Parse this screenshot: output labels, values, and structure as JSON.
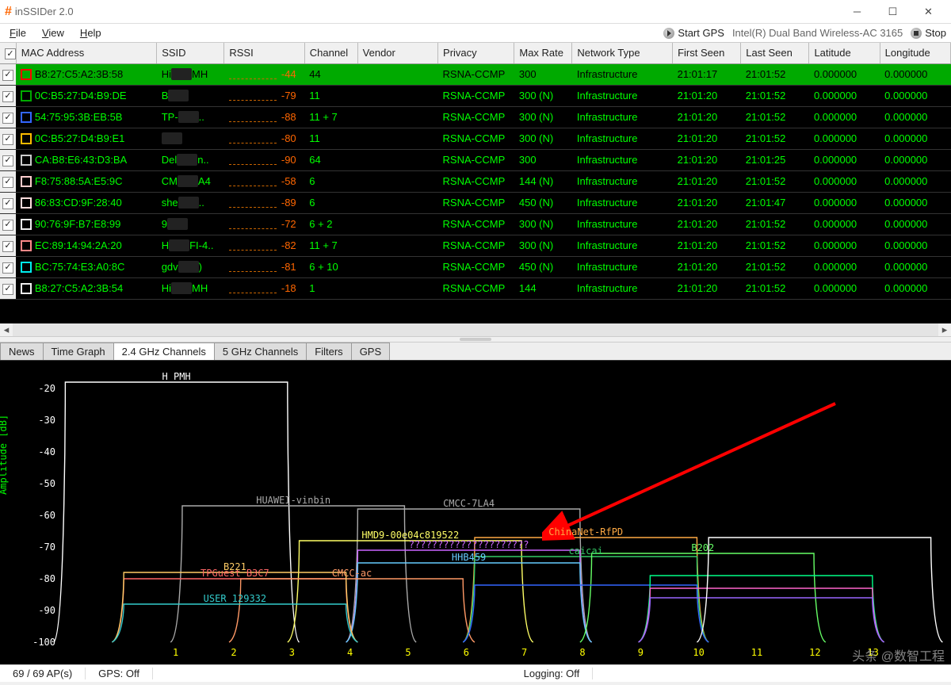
{
  "window": {
    "title": "inSSIDer 2.0",
    "logo": "#"
  },
  "menu": {
    "file": "File",
    "view": "View",
    "help": "Help",
    "start_gps": "Start GPS",
    "adapter": "Intel(R) Dual Band Wireless-AC 3165",
    "stop": "Stop"
  },
  "columns": [
    "MAC Address",
    "SSID",
    "RSSI",
    "Channel",
    "Vendor",
    "Privacy",
    "Max Rate",
    "Network Type",
    "First Seen",
    "Last Seen",
    "Latitude",
    "Longitude"
  ],
  "rows": [
    {
      "chip": "#f00",
      "mac": "B8:27:C5:A2:3B:58",
      "ssid": "Hi",
      "ssid_ob": "MH",
      "rssi": -44,
      "ch": "44",
      "vendor": "",
      "privacy": "RSNA-CCMP",
      "rate": "300",
      "ntype": "Infrastructure",
      "first": "21:01:17",
      "last": "21:01:52",
      "lat": "0.000000",
      "lon": "0.000000",
      "sel": true
    },
    {
      "chip": "#0a0",
      "mac": "0C:B5:27:D4:B9:DE",
      "ssid": "B",
      "ssid_ob": "",
      "rssi": -79,
      "ch": "11",
      "vendor": "",
      "privacy": "RSNA-CCMP",
      "rate": "300 (N)",
      "ntype": "Infrastructure",
      "first": "21:01:20",
      "last": "21:01:52",
      "lat": "0.000000",
      "lon": "0.000000"
    },
    {
      "chip": "#36f",
      "mac": "54:75:95:3B:EB:5B",
      "ssid": "TP-",
      "ssid_ob": "..",
      "rssi": -88,
      "ch": "11 + 7",
      "vendor": "",
      "privacy": "RSNA-CCMP",
      "rate": "300 (N)",
      "ntype": "Infrastructure",
      "first": "21:01:20",
      "last": "21:01:52",
      "lat": "0.000000",
      "lon": "0.000000"
    },
    {
      "chip": "#fb0",
      "mac": "0C:B5:27:D4:B9:E1",
      "ssid": "",
      "ssid_ob": "",
      "rssi": -80,
      "ch": "11",
      "vendor": "",
      "privacy": "RSNA-CCMP",
      "rate": "300 (N)",
      "ntype": "Infrastructure",
      "first": "21:01:20",
      "last": "21:01:52",
      "lat": "0.000000",
      "lon": "0.000000"
    },
    {
      "chip": "#ccc",
      "mac": "CA:B8:E6:43:D3:BA",
      "ssid": "Del",
      "ssid_ob": "n..",
      "rssi": -90,
      "ch": "64",
      "vendor": "",
      "privacy": "RSNA-CCMP",
      "rate": "300",
      "ntype": "Infrastructure",
      "first": "21:01:20",
      "last": "21:01:25",
      "lat": "0.000000",
      "lon": "0.000000"
    },
    {
      "chip": "#fcc",
      "mac": "F8:75:88:5A:E5:9C",
      "ssid": "CM",
      "ssid_ob": "A4",
      "rssi": -58,
      "ch": "6",
      "vendor": "",
      "privacy": "RSNA-CCMP",
      "rate": "144 (N)",
      "ntype": "Infrastructure",
      "first": "21:01:20",
      "last": "21:01:52",
      "lat": "0.000000",
      "lon": "0.000000"
    },
    {
      "chip": "#fdd",
      "mac": "86:83:CD:9F:28:40",
      "ssid": "she",
      "ssid_ob": "..",
      "rssi": -89,
      "ch": "6",
      "vendor": "",
      "privacy": "RSNA-CCMP",
      "rate": "450 (N)",
      "ntype": "Infrastructure",
      "first": "21:01:20",
      "last": "21:01:47",
      "lat": "0.000000",
      "lon": "0.000000"
    },
    {
      "chip": "#eee",
      "mac": "90:76:9F:B7:E8:99",
      "ssid": "9",
      "ssid_ob": "",
      "rssi": -72,
      "ch": "6 + 2",
      "vendor": "",
      "privacy": "RSNA-CCMP",
      "rate": "300 (N)",
      "ntype": "Infrastructure",
      "first": "21:01:20",
      "last": "21:01:52",
      "lat": "0.000000",
      "lon": "0.000000"
    },
    {
      "chip": "#f88",
      "mac": "EC:89:14:94:2A:20",
      "ssid": "H",
      "ssid_ob": "FI-4..",
      "rssi": -82,
      "ch": "11 + 7",
      "vendor": "",
      "privacy": "RSNA-CCMP",
      "rate": "300 (N)",
      "ntype": "Infrastructure",
      "first": "21:01:20",
      "last": "21:01:52",
      "lat": "0.000000",
      "lon": "0.000000"
    },
    {
      "chip": "#0ee",
      "mac": "BC:75:74:E3:A0:8C",
      "ssid": "gdv",
      "ssid_ob": ")",
      "rssi": -81,
      "ch": "6 + 10",
      "vendor": "",
      "privacy": "RSNA-CCMP",
      "rate": "450 (N)",
      "ntype": "Infrastructure",
      "first": "21:01:20",
      "last": "21:01:52",
      "lat": "0.000000",
      "lon": "0.000000"
    },
    {
      "chip": "#eee",
      "mac": "B8:27:C5:A2:3B:54",
      "ssid": "Hi",
      "ssid_ob": "MH",
      "rssi": -18,
      "ch": "1",
      "vendor": "",
      "privacy": "RSNA-CCMP",
      "rate": "144",
      "ntype": "Infrastructure",
      "first": "21:01:20",
      "last": "21:01:52",
      "lat": "0.000000",
      "lon": "0.000000"
    }
  ],
  "tabs": {
    "items": [
      "News",
      "Time Graph",
      "2.4 GHz Channels",
      "5 GHz Channels",
      "Filters",
      "GPS"
    ],
    "active": 2
  },
  "chart_data": {
    "type": "line",
    "title": "",
    "ylabel": "Amplitude [dB]",
    "ylim": [
      -100,
      -15
    ],
    "yticks": [
      -20,
      -30,
      -40,
      -50,
      -60,
      -70,
      -80,
      -90,
      -100
    ],
    "xlabel": "",
    "xlim": [
      -1,
      14
    ],
    "xticks": [
      1,
      2,
      3,
      4,
      5,
      6,
      7,
      8,
      9,
      10,
      11,
      12,
      13
    ],
    "series": [
      {
        "name": "H    PMH",
        "center": 1,
        "amp": -18,
        "color": "#ffffff"
      },
      {
        "name": "HUAWEI-vinbin",
        "center": 3,
        "amp": -57,
        "color": "#aaaaaa"
      },
      {
        "name": "CMCC-7LA4",
        "center": 6,
        "amp": -58,
        "color": "#aaaaaa"
      },
      {
        "name": "HMD9-00e04c819522",
        "center": 5,
        "amp": -68,
        "color": "#ffff66"
      },
      {
        "name": "ChinaNet-RfPD",
        "center": 8,
        "amp": -67,
        "color": "#ffaa44"
      },
      {
        "name": "caicai",
        "center": 8,
        "amp": -73,
        "color": "#33cc66"
      },
      {
        "name": "?????????????????????",
        "center": 6,
        "amp": -71,
        "color": "#cc66ff"
      },
      {
        "name": "HHB459",
        "center": 6,
        "amp": -75,
        "color": "#66ccff"
      },
      {
        "name": "B202",
        "center": 10,
        "amp": -72,
        "color": "#66ff66"
      },
      {
        "name": "TPGuest_B3C7",
        "center": 2,
        "amp": -80,
        "color": "#ff6666"
      },
      {
        "name": "CMCC-ac",
        "center": 4,
        "amp": -80,
        "color": "#ff9966"
      },
      {
        "name": "B221",
        "center": 2,
        "amp": -78,
        "color": "#ffcc66"
      },
      {
        "name": "USER_129332",
        "center": 2,
        "amp": -88,
        "color": "#33cccc"
      },
      {
        "name": "",
        "center": 8,
        "amp": -82,
        "color": "#3366ff"
      },
      {
        "name": "",
        "center": 11,
        "amp": -79,
        "color": "#00ff88"
      },
      {
        "name": "",
        "center": 11,
        "amp": -83,
        "color": "#ff66cc"
      },
      {
        "name": "",
        "center": 11,
        "amp": -86,
        "color": "#9966ff"
      },
      {
        "name": "",
        "center": 12,
        "amp": -67,
        "color": "#ffffff"
      }
    ]
  },
  "status": {
    "aps": "69 / 69 AP(s)",
    "gps": "GPS: Off",
    "logging": "Logging:  Off"
  },
  "watermark": "头条 @数智工程"
}
